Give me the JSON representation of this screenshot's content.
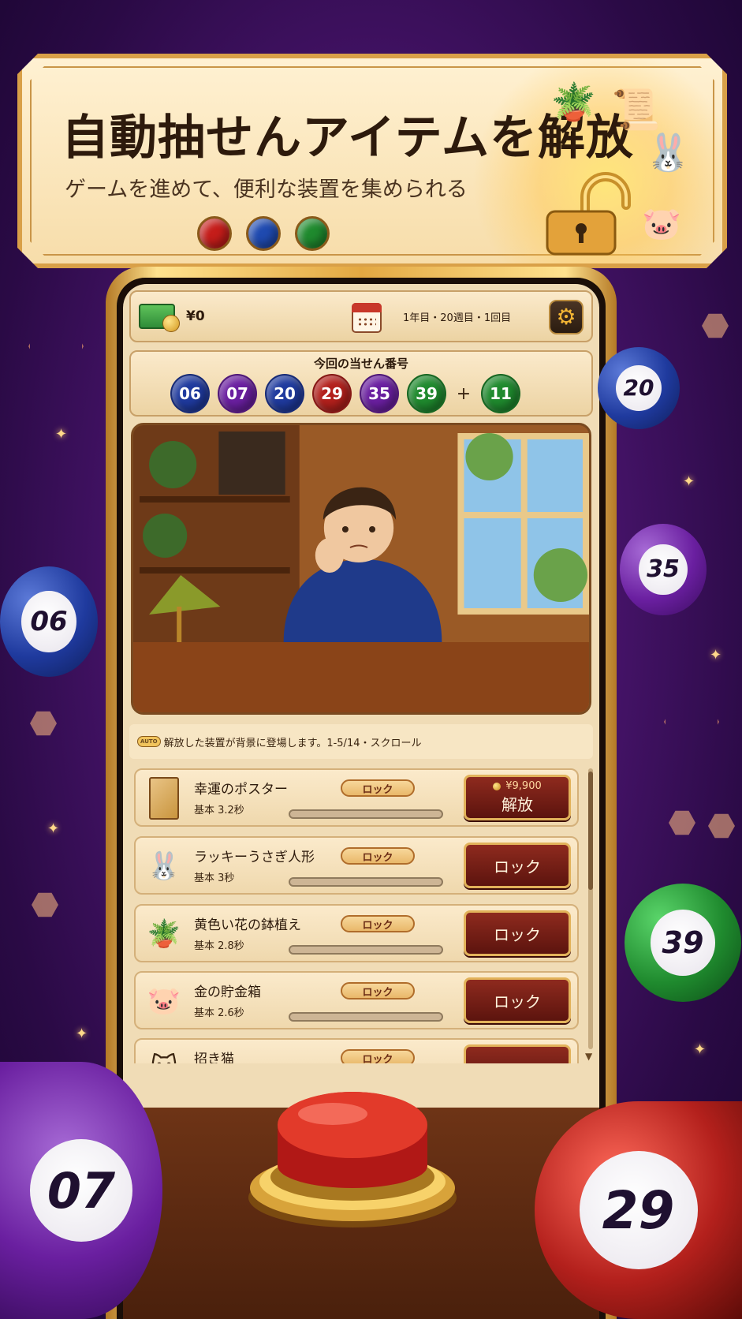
{
  "banner": {
    "title": "自動抽せんアイテムを解放",
    "subtitle": "ゲームを進めて、便利な装置を集められる"
  },
  "topbar": {
    "money": "¥0",
    "date": "1年目・20週目・1回目",
    "icons": {
      "money": "cash-icon",
      "calendar": "calendar-icon",
      "settings": "gear-icon"
    }
  },
  "lottery": {
    "title": "今回の当せん番号",
    "numbers": [
      {
        "value": "06",
        "color": "#1f3a9e"
      },
      {
        "value": "07",
        "color": "#6a1fa0"
      },
      {
        "value": "20",
        "color": "#1f3a9e"
      },
      {
        "value": "29",
        "color": "#b3201c"
      },
      {
        "value": "35",
        "color": "#6a1fa0"
      },
      {
        "value": "39",
        "color": "#1f8a2e"
      }
    ],
    "plus": "+",
    "bonus": {
      "value": "11",
      "color": "#1f8a2e"
    }
  },
  "hint": {
    "badge": "AUTO",
    "text": "解放した装置が背景に登場します。1-5/14・スクロール"
  },
  "items": [
    {
      "name": "幸運のポスター",
      "base": "基本 3.2秒",
      "tag": "ロック",
      "icon": "poster-icon",
      "price": "¥9,900",
      "action": "解放"
    },
    {
      "name": "ラッキーうさぎ人形",
      "base": "基本 3秒",
      "tag": "ロック",
      "icon": "rabbit-doll-icon",
      "action": "ロック"
    },
    {
      "name": "黄色い花の鉢植え",
      "base": "基本 2.8秒",
      "tag": "ロック",
      "icon": "flower-pot-icon",
      "action": "ロック"
    },
    {
      "name": "金の貯金箱",
      "base": "基本 2.6秒",
      "tag": "ロック",
      "icon": "piggy-bank-icon",
      "action": "ロック"
    },
    {
      "name": "招き猫",
      "base": "",
      "tag": "ロック",
      "icon": "lucky-cat-icon",
      "action": ""
    }
  ],
  "floating_balls": [
    {
      "value": "20",
      "color": "#1f3a9e"
    },
    {
      "value": "06",
      "color": "#1f3a9e"
    },
    {
      "value": "35",
      "color": "#6a1fa0"
    },
    {
      "value": "39",
      "color": "#1f8a2e"
    },
    {
      "value": "07",
      "color": "#6a1fa0"
    },
    {
      "value": "29",
      "color": "#b3201c"
    }
  ],
  "colors": {
    "accent_gold": "#e3a842",
    "button_red": "#8e2a1e",
    "background_purple": "#4b1570"
  }
}
